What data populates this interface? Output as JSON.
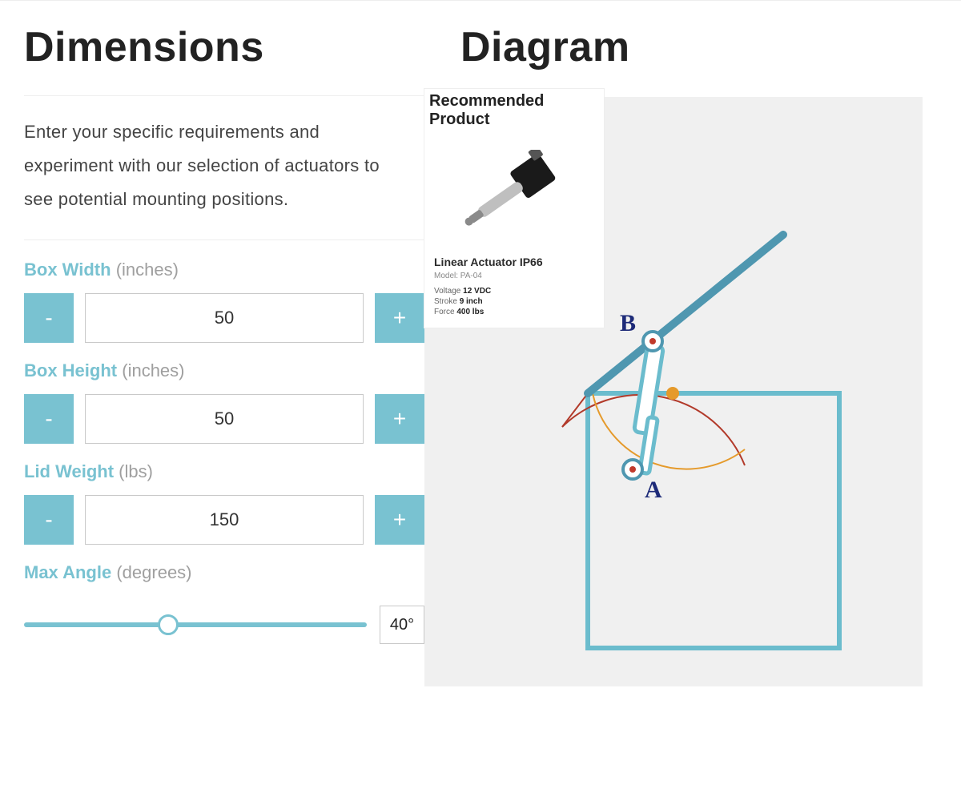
{
  "dimensions": {
    "heading": "Dimensions",
    "intro": "Enter your specific requirements and experiment with our selection of actuators to see potential mounting positions.",
    "fields": {
      "box_width": {
        "label": "Box Width",
        "unit": "(inches)",
        "value": "50"
      },
      "box_height": {
        "label": "Box Height",
        "unit": "(inches)",
        "value": "50"
      },
      "lid_weight": {
        "label": "Lid Weight",
        "unit": "(lbs)",
        "value": "150"
      },
      "max_angle": {
        "label": "Max Angle",
        "unit": "(degrees)",
        "value": "40°",
        "slider_percent": 42
      }
    },
    "buttons": {
      "minus": "-",
      "plus": "+"
    }
  },
  "diagram": {
    "heading": "Diagram",
    "points": {
      "A": "A",
      "B": "B"
    }
  },
  "product": {
    "recommended_label": "Recommended Product",
    "title": "Linear Actuator IP66",
    "model_label": "Model:",
    "model": "PA-04",
    "specs": [
      {
        "k": "Voltage",
        "v": "12 VDC"
      },
      {
        "k": "Stroke",
        "v": "9 inch"
      },
      {
        "k": "Force",
        "v": "400 lbs"
      }
    ]
  }
}
